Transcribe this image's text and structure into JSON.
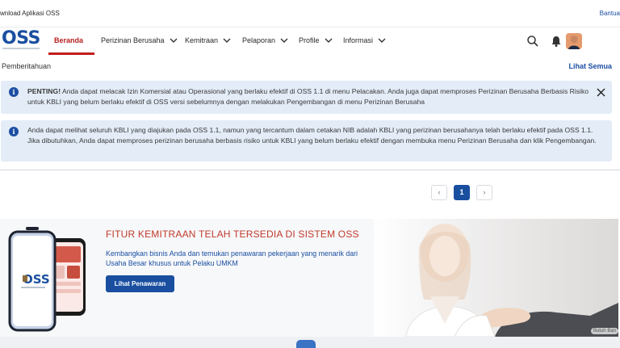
{
  "topbar": {
    "download_text": "wnload Aplikasi OSS",
    "help_text": "Bantua"
  },
  "logo": {
    "text": "OSS"
  },
  "nav": {
    "items": [
      {
        "label": "Beranda",
        "active": true
      },
      {
        "label": "Perizinan Berusaha"
      },
      {
        "label": "Kemitraan"
      },
      {
        "label": "Pelaporan"
      },
      {
        "label": "Profile"
      },
      {
        "label": "Informasi"
      }
    ],
    "icons": [
      "search-icon",
      "bell-icon",
      "avatar"
    ]
  },
  "notifications": {
    "heading": "Pemberitahuan",
    "see_all": "Lihat Semua",
    "alerts": [
      {
        "bold": "PENTING!",
        "text": " Anda dapat melacak Izin Komersial atau Operasional yang berlaku efektif di OSS 1.1 di menu Pelacakan. Anda juga dapat memproses Perizinan Berusaha Berbasis Risiko untuk KBLI yang belum berlaku efektif di OSS versi sebelumnya dengan melakukan Pengembangan di menu Perizinan Berusaha"
      },
      {
        "text": "Anda dapat melihat seluruh KBLI yang diajukan pada OSS 1.1, namun yang tercantum dalam cetakan NIB adalah KBLI yang perizinan berusahanya telah berlaku efektif pada OSS 1.1. Jika dibutuhkan, Anda dapat memproses perizinan berusaha berbasis risiko untuk KBLI yang belum berlaku efektif dengan membuka menu Perizinan Berusaha dan klik Pengembangan."
      }
    ]
  },
  "pagination": {
    "current": "1",
    "prev": "‹",
    "next": "›"
  },
  "banner": {
    "title": "FITUR KEMITRAAN TELAH TERSEDIA DI SISTEM OSS",
    "description": "Kembangkan bisnis Anda dan temukan penawaran pekerjaan yang menarik dari Usaha Besar khusus untuk Pelaku UMKM",
    "button": "Lihat Penawaran",
    "photo_caption": "Butuh Ban"
  },
  "colors": {
    "primary": "#1a4fa0",
    "accent_red": "#c21d1d",
    "alert_bg": "#e3ecf7"
  }
}
